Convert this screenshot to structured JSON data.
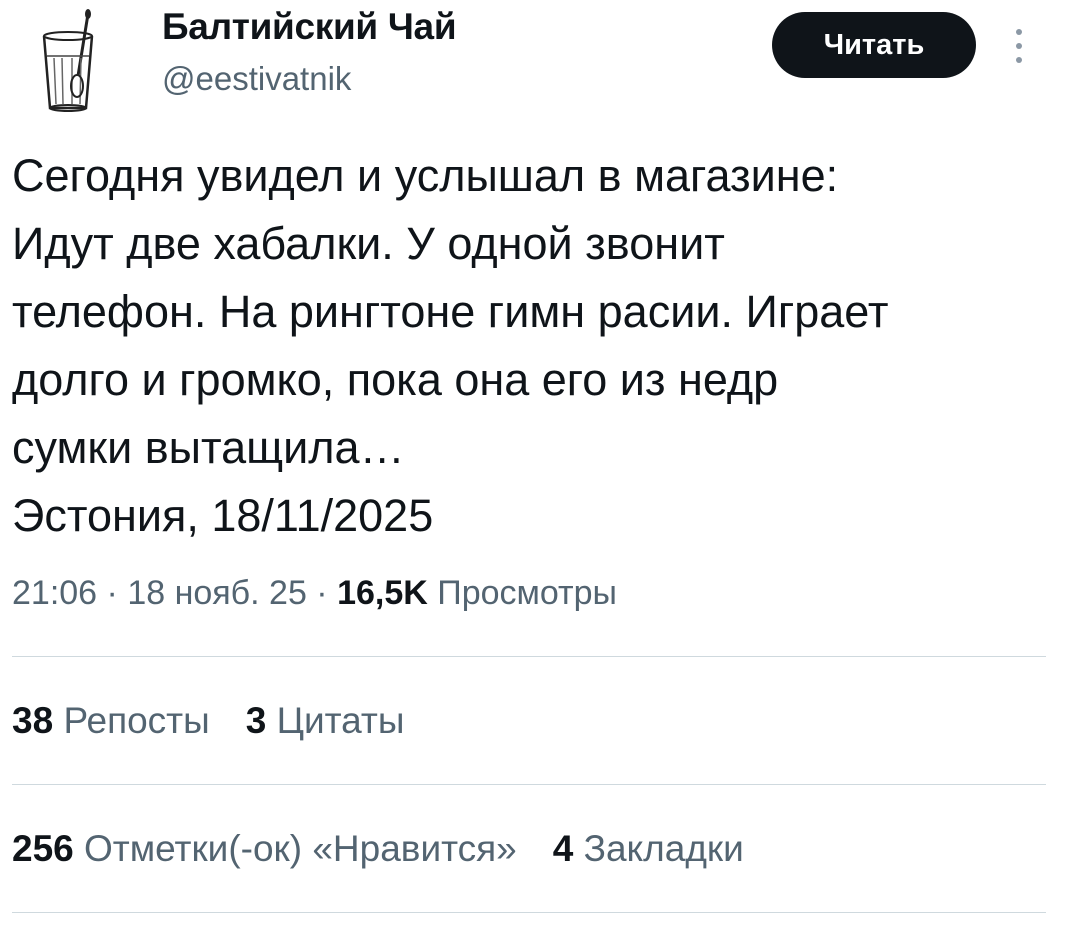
{
  "author": {
    "name": "Балтийский Чай",
    "handle": "@eestivatnik",
    "avatar_icon": "tea-glass-icon"
  },
  "follow_button": {
    "label": "Читать"
  },
  "more_menu": {
    "icon": "more-vertical-icon"
  },
  "tweet": {
    "text": "Сегодня увидел и услышал в магазине:\nИдут две хабалки. У одной звонит\nтелефон. На рингтоне гимн расии. Играет\nдолго и громко, пока она его из недр\nсумки вытащила…\nЭстония, 18/11/2025",
    "time": "21:06",
    "separator": " · ",
    "date": "18 нояб. 25",
    "views_count": "16,5K",
    "views_label": "Просмотры"
  },
  "stats": {
    "reposts_count": "38",
    "reposts_label": "Репосты",
    "quotes_count": "3",
    "quotes_label": "Цитаты",
    "likes_count": "256",
    "likes_label": "Отметки(-ок) «Нравится»",
    "bookmarks_count": "4",
    "bookmarks_label": "Закладки"
  },
  "colors": {
    "text_primary": "#0f1419",
    "text_secondary": "#536471",
    "divider": "#cfd9de",
    "button_bg": "#0f1419",
    "button_text": "#ffffff"
  }
}
